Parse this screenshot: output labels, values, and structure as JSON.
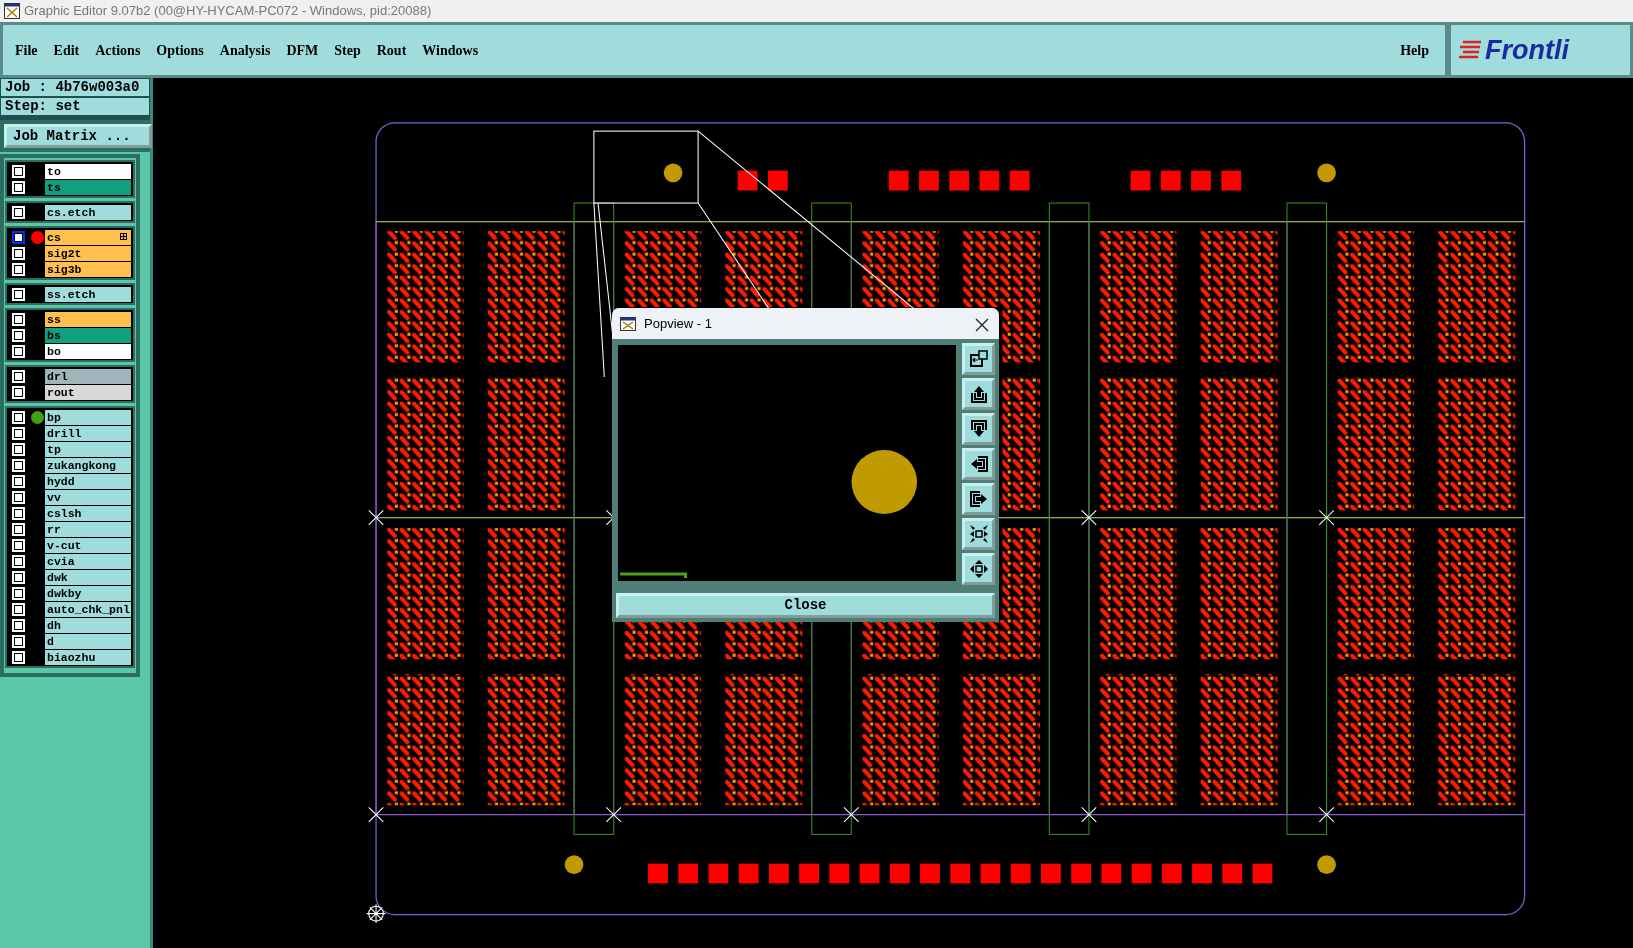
{
  "window": {
    "title": "Graphic Editor 9.07b2 (00@HY-HYCAM-PC072 - Windows, pid:20088)"
  },
  "menu": [
    "File",
    "Edit",
    "Actions",
    "Options",
    "Analysis",
    "DFM",
    "Step",
    "Rout",
    "Windows"
  ],
  "help": "Help",
  "logo": "Frontli",
  "job": "Job : 4b76w003a0",
  "step": "Step: set",
  "job_matrix_button": "Job Matrix ...",
  "layer_groups": [
    {
      "layers": [
        {
          "name": "to",
          "color": "#ffffff",
          "checked": false,
          "work_layer": false
        },
        {
          "name": "ts",
          "color": "#10a080",
          "checked": false,
          "work_layer": false
        }
      ]
    },
    {
      "layers": [
        {
          "name": "cs.etch",
          "color": "#a0dcdc",
          "checked": false,
          "work_layer": false
        }
      ]
    },
    {
      "layers": [
        {
          "name": "cs",
          "color": "#ffc050",
          "checked": false,
          "work_layer": true
        },
        {
          "name": "sig2t",
          "color": "#ffc050",
          "checked": false,
          "work_layer": false
        },
        {
          "name": "sig3b",
          "color": "#ffc050",
          "checked": false,
          "work_layer": false
        }
      ]
    },
    {
      "layers": [
        {
          "name": "ss.etch",
          "color": "#a0dcdc",
          "checked": false,
          "work_layer": false
        }
      ]
    },
    {
      "layers": [
        {
          "name": "ss",
          "color": "#ffc050",
          "checked": false,
          "work_layer": false
        },
        {
          "name": "bs",
          "color": "#10a080",
          "checked": false,
          "work_layer": false
        },
        {
          "name": "bo",
          "color": "#ffffff",
          "checked": false,
          "work_layer": false
        }
      ]
    },
    {
      "layers": [
        {
          "name": "drl",
          "color": "#a0b4bc",
          "checked": false,
          "work_layer": false
        },
        {
          "name": "rout",
          "color": "#d8d8d8",
          "checked": false,
          "work_layer": false
        }
      ]
    },
    {
      "layers": [
        {
          "name": "bp",
          "color": "#a0dcdc",
          "checked": false,
          "work_layer": false,
          "affected": true
        },
        {
          "name": "drill",
          "color": "#a0dcdc",
          "checked": false,
          "work_layer": false
        },
        {
          "name": "tp",
          "color": "#a0dcdc",
          "checked": false,
          "work_layer": false
        },
        {
          "name": "zukangkong",
          "color": "#a0dcdc",
          "checked": false,
          "work_layer": false
        },
        {
          "name": "hydd",
          "color": "#a0dcdc",
          "checked": false,
          "work_layer": false
        },
        {
          "name": "vv",
          "color": "#a0dcdc",
          "checked": false,
          "work_layer": false
        },
        {
          "name": "cslsh",
          "color": "#a0dcdc",
          "checked": false,
          "work_layer": false
        },
        {
          "name": "rr",
          "color": "#a0dcdc",
          "checked": false,
          "work_layer": false
        },
        {
          "name": "v-cut",
          "color": "#a0dcdc",
          "checked": false,
          "work_layer": false
        },
        {
          "name": "cvia",
          "color": "#a0dcdc",
          "checked": false,
          "work_layer": false
        },
        {
          "name": "dwk",
          "color": "#a0dcdc",
          "checked": false,
          "work_layer": false
        },
        {
          "name": "dwkby",
          "color": "#a0dcdc",
          "checked": false,
          "work_layer": false
        },
        {
          "name": "auto_chk_pnl",
          "color": "#a0dcdc",
          "checked": false,
          "work_layer": false
        },
        {
          "name": "dh",
          "color": "#a0dcdc",
          "checked": false,
          "work_layer": false
        },
        {
          "name": "d",
          "color": "#a0dcdc",
          "checked": false,
          "work_layer": false
        },
        {
          "name": "biaozhu",
          "color": "#a0dcdc",
          "checked": false,
          "work_layer": false
        }
      ]
    }
  ],
  "popview": {
    "title": "Popview - 1",
    "close_button": "Close"
  }
}
